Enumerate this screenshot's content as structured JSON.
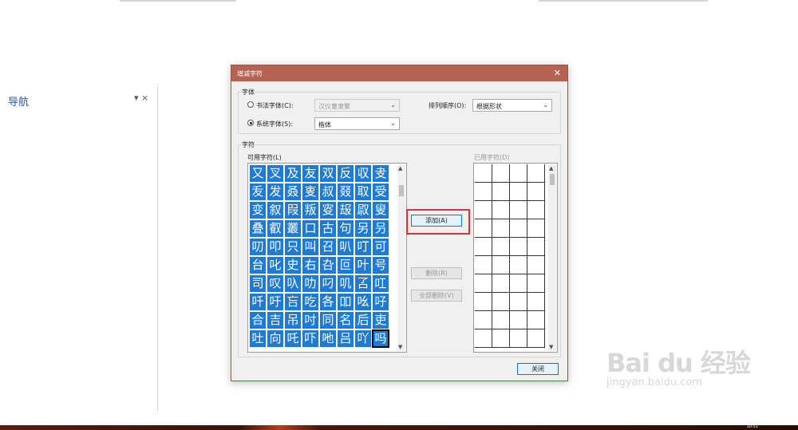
{
  "navigation": {
    "title": "导航",
    "controls": "▾ ×"
  },
  "dialog": {
    "title": "增减字符",
    "close_glyph": "✕",
    "font_group": {
      "label": "字体",
      "calligraphy_label": "书法字体(C):",
      "calligraphy_value": "汉仪曹隶繁",
      "system_label": "系统字体(S):",
      "system_value": "楷体",
      "sort_label": "排列顺序(O):",
      "sort_value": "根据形状"
    },
    "chars_group": {
      "label": "字符",
      "available_label": "可用字符(L)",
      "used_label": "已用字符(D)",
      "available_chars": [
        [
          "又",
          "叉",
          "及",
          "友",
          "双",
          "反",
          "収",
          "叏"
        ],
        [
          "叐",
          "发",
          "叒",
          "叓",
          "叔",
          "叕",
          "取",
          "受"
        ],
        [
          "变",
          "叙",
          "叚",
          "叛",
          "叜",
          "叝",
          "叞",
          "叟"
        ],
        [
          "叠",
          "叡",
          "叢",
          "口",
          "古",
          "句",
          "另",
          "叧"
        ],
        [
          "叨",
          "叩",
          "只",
          "叫",
          "召",
          "叭",
          "叮",
          "可"
        ],
        [
          "台",
          "叱",
          "史",
          "右",
          "叴",
          "叵",
          "叶",
          "号"
        ],
        [
          "司",
          "叹",
          "叺",
          "叻",
          "叼",
          "叽",
          "叾",
          "叿"
        ],
        [
          "吀",
          "吁",
          "吂",
          "吃",
          "各",
          "吅",
          "吆",
          "吇"
        ],
        [
          "合",
          "吉",
          "吊",
          "吋",
          "同",
          "名",
          "后",
          "吏"
        ],
        [
          "吐",
          "向",
          "吒",
          "吓",
          "吔",
          "吕",
          "吖",
          "吗"
        ]
      ],
      "selected_char": "吗"
    },
    "buttons": {
      "add": "添加(A)",
      "delete": "删除(R)",
      "delete_all": "全部删除(V)",
      "close": "关闭"
    }
  },
  "watermark": {
    "main": "Bai du 经验",
    "sub": "jingyan.baidu.com"
  },
  "taskbar": {
    "clock": "10:51"
  }
}
